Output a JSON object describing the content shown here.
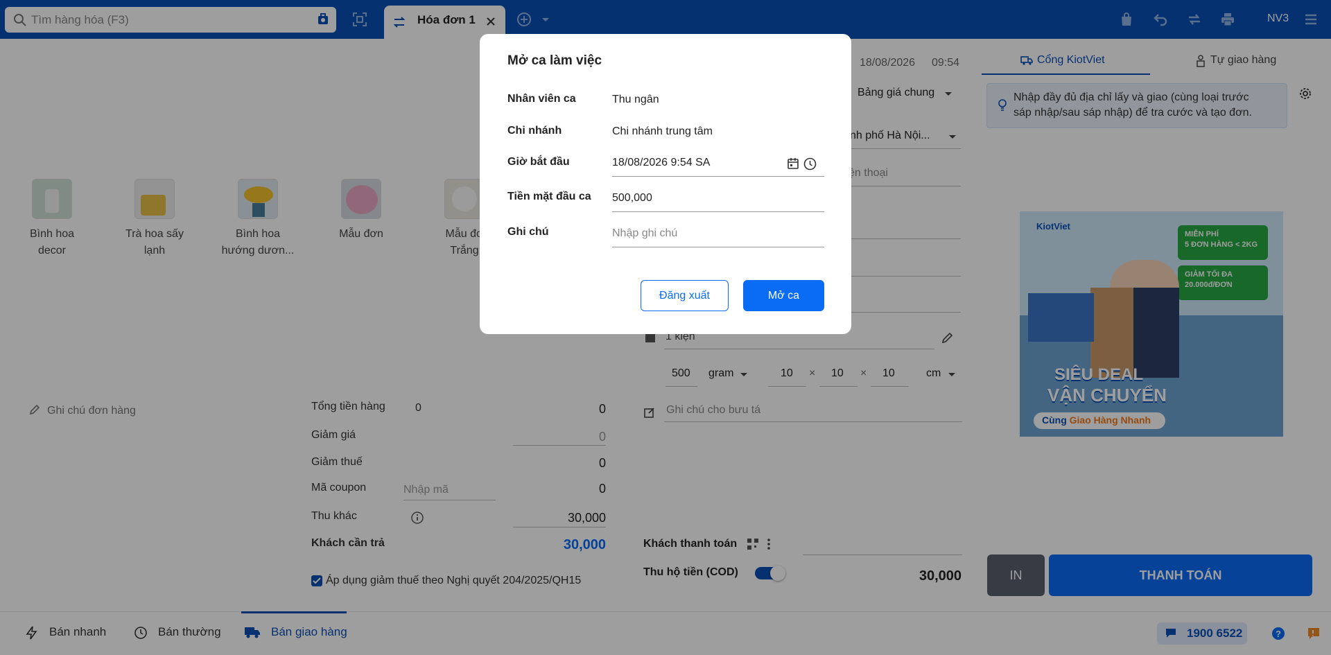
{
  "topbar": {
    "search_placeholder": "Tìm hàng hóa (F3)",
    "tab_label": "Hóa đơn 1",
    "user": "NV3"
  },
  "products": [
    {
      "name_line1": "Bình hoa",
      "name_line2": "decor"
    },
    {
      "name_line1": "Trà hoa sấy",
      "name_line2": "lạnh"
    },
    {
      "name_line1": "Bình hoa",
      "name_line2": "hướng dươn..."
    },
    {
      "name_line1": "Mẫu đơn",
      "name_line2": ""
    },
    {
      "name_line1": "Mẫu đơ",
      "name_line2": "Trắng"
    }
  ],
  "order_summary": {
    "note_placeholder": "Ghi chú đơn hàng",
    "total_goods_label": "Tổng tiền hàng",
    "total_goods_qty": "0",
    "total_goods_value": "0",
    "discount_label": "Giảm giá",
    "discount_value": "0",
    "tax_discount_label": "Giảm thuế",
    "tax_discount_value": "0",
    "coupon_label": "Mã coupon",
    "coupon_placeholder": "Nhập mã",
    "coupon_value": "0",
    "other_income_label": "Thu khác",
    "other_income_value": "30,000",
    "customer_pay_label": "Khách cần trả",
    "customer_pay_value": "30,000",
    "tax_checkbox_label": "Áp dụng giảm thuế theo Nghị quyết 204/2025/QH15"
  },
  "middle": {
    "date": "18/08/2026",
    "time": "09:54",
    "price_list": "Bảng giá chung",
    "city": "nh phố Hà Nội...",
    "phone_placeholder": "ện thoại",
    "package": "1 kiện",
    "weight": "500",
    "weight_unit": "gram",
    "dim_l": "10",
    "dim_w": "10",
    "dim_h": "10",
    "dim_unit": "cm",
    "courier_note_placeholder": "Ghi chú cho bưu tá",
    "customer_payment_label": "Khách thanh toán",
    "cod_label": "Thu hộ tiền (COD)",
    "cod_value": "30,000"
  },
  "right": {
    "tab1": "Cổng KiotViet",
    "tab2": "Tự giao hàng",
    "info_text_1": "Nhập đầy đủ địa chỉ lấy và giao (cùng loại trước",
    "info_text_2": "sáp nhập/sau sáp nhập) để tra cước và tạo đơn.",
    "print_button": "IN",
    "pay_button": "THANH TOÁN",
    "banner": {
      "brand": "KiotViet",
      "promo1_a": "MIỄN PHÍ",
      "promo1_b": "5 ĐƠN HÀNG < 2KG",
      "promo2_a": "GIẢM TỐI ĐA",
      "promo2_b": "20.000đ/ĐƠN",
      "headline1": "SIÊU DEAL",
      "headline2": "VẬN CHUYỂN",
      "tagline_a": "Cùng ",
      "tagline_b": "Giao Hàng Nhanh"
    }
  },
  "bottom": {
    "nav1": "Bán nhanh",
    "nav2": "Bán thường",
    "nav3": "Bán giao hàng",
    "hotline": "1900 6522"
  },
  "modal": {
    "title": "Mở ca làm việc",
    "staff_label": "Nhân viên ca",
    "staff_value": "Thu ngân",
    "branch_label": "Chi nhánh",
    "branch_value": "Chi nhánh trung tâm",
    "start_label": "Giờ bắt đầu",
    "start_value": "18/08/2026 9:54 SA",
    "cash_label": "Tiền mặt đầu ca",
    "cash_value": "500,000",
    "note_label": "Ghi chú",
    "note_placeholder": "Nhập ghi chú",
    "logout_button": "Đăng xuất",
    "open_button": "Mở ca"
  },
  "colors": {
    "brand_blue": "#0a4fb5",
    "primary_button": "#0a6cf5",
    "print_button": "#59626e"
  }
}
